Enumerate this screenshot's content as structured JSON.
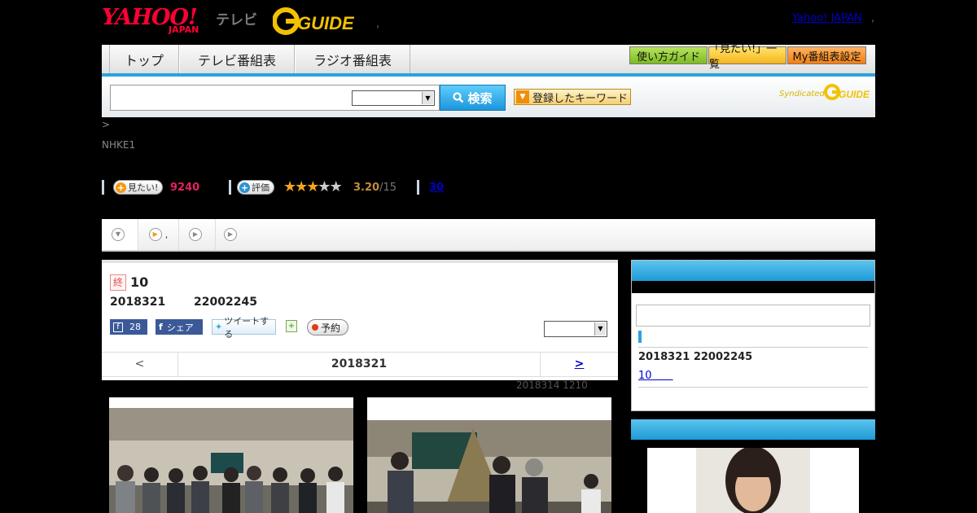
{
  "header": {
    "logo_yahoo": "YAHOO!",
    "logo_japan": "JAPAN",
    "logo_tv": "テレビ",
    "logo_gguide": "G-GUIDE",
    "yahoo_japan_link": "Yahoo! JAPAN",
    "dot1": ",",
    "dot2": ","
  },
  "nav": {
    "tabs": [
      {
        "label": "トップ"
      },
      {
        "label": "テレビ番組表"
      },
      {
        "label": "ラジオ番組表"
      }
    ],
    "buttons": [
      {
        "label": "使い方ガイド",
        "color": "#8cc63f"
      },
      {
        "label": "「見たい!」一覧",
        "color": "#f9c22e"
      },
      {
        "label": "My番組表設定",
        "color": "#f7941d"
      }
    ]
  },
  "search": {
    "input_value": "",
    "select_value": "",
    "button_label": "検索",
    "keyword_button_label": "登録したキーワード",
    "syndicated_label": "Syndicated"
  },
  "breadcrumb": ">",
  "channel": "NHKE1",
  "stats": {
    "mitai_label": "見たい!",
    "mitai_count": "9240",
    "rating_label": "評価",
    "rating_value": "3.20",
    "rating_total": "/15",
    "rating_stars": 3.2,
    "reviews_count": "30"
  },
  "content_tabs": [
    {
      "label": "",
      "icon": "dropdown-circle-icon"
    },
    {
      "label": ",",
      "icon": "play-circle-icon"
    },
    {
      "label": "",
      "icon": "play-circle-icon"
    },
    {
      "label": "",
      "icon": "play-circle-icon"
    }
  ],
  "program": {
    "end_badge": "終",
    "title": "10",
    "date": "2018321",
    "time": "22002245",
    "like_count": "28",
    "share_label": "シェア",
    "tweet_label": "ツイートする",
    "reserve_label": "予約",
    "select_value": "",
    "prev_label": "<",
    "nav_date": "2018321",
    "next_label": ">",
    "updated": "2018314  1210"
  },
  "sidebar": {
    "input_value": "",
    "datetime": "2018321  22002245",
    "episode_link": "10　　"
  },
  "colors": {
    "accent_blue": "#2aa3dc",
    "mitai_pink": "#e0245e",
    "star_gold": "#f5a51c"
  }
}
